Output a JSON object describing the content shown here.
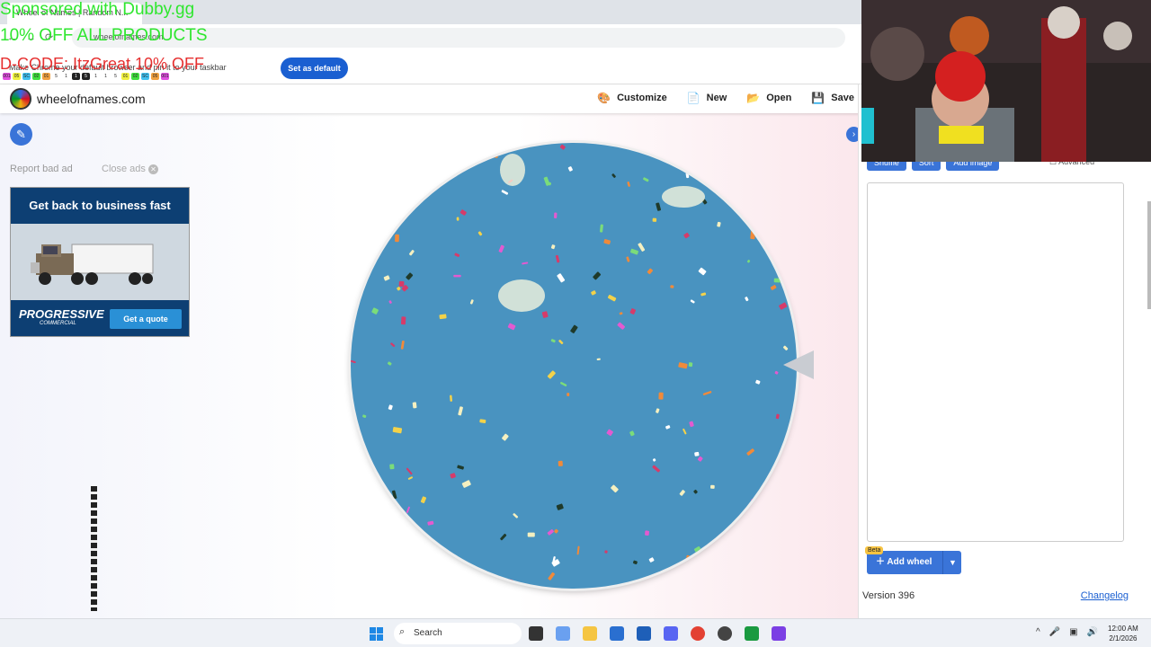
{
  "browser": {
    "tab_title": "Wheel of Names | Random N...",
    "url": "wheelofnames.com",
    "infobar_text": "Make Chrome your default browser and pin it to your taskbar",
    "set_default_label": "Set as default"
  },
  "stream_overlay": {
    "line1": "Sponsored with Dubby.gg",
    "line2": "10% OFF ALL PRODUCTS",
    "line3": "D-CODE: ItzGreat 10% OFF",
    "chips": [
      {
        "label": "001",
        "color": "#e050e0"
      },
      {
        "label": "05",
        "color": "#f0f040"
      },
      {
        "label": "SC",
        "color": "#40c0f0"
      },
      {
        "label": "02",
        "color": "#40e040"
      },
      {
        "label": "01",
        "color": "#f0a040"
      },
      {
        "label": "5",
        "color": "#ffffff"
      },
      {
        "label": "1",
        "color": "#ffffff"
      },
      {
        "label": "1",
        "color": "#222222"
      },
      {
        "label": "5",
        "color": "#222222"
      },
      {
        "label": "1",
        "color": "#ffffff"
      },
      {
        "label": "1",
        "color": "#ffffff"
      },
      {
        "label": "5",
        "color": "#ffffff"
      },
      {
        "label": "01",
        "color": "#f0f040"
      },
      {
        "label": "02",
        "color": "#40e040"
      },
      {
        "label": "SC",
        "color": "#40c0f0"
      },
      {
        "label": "05",
        "color": "#f0a040"
      },
      {
        "label": "001",
        "color": "#e050e0"
      }
    ]
  },
  "site": {
    "name": "wheelofnames.com",
    "menu": [
      {
        "label": "Customize",
        "icon": "palette-icon",
        "glyph": "🎨"
      },
      {
        "label": "New",
        "icon": "new-file-icon",
        "glyph": "📄"
      },
      {
        "label": "Open",
        "icon": "folder-open-icon",
        "glyph": "📂"
      },
      {
        "label": "Save",
        "icon": "save-icon",
        "glyph": "💾"
      }
    ],
    "report_label": "Report bad ad",
    "close_ads_label": "Close ads"
  },
  "ad": {
    "headline": "Get back to business fast",
    "brand": "PROGRESSIVE",
    "brand_sub": "COMMERCIAL",
    "cta": "Get a quote"
  },
  "panel": {
    "shuffle_label": "Shuffle",
    "sort_label": "Sort",
    "add_image_label": "Add image",
    "advanced_label": "Advanced",
    "add_wheel_label": "Add wheel",
    "beta_badge": "Beta",
    "version": "Version 396",
    "changelog": "Changelog"
  },
  "taskbar": {
    "search_placeholder": "Search",
    "time": "12:00 AM",
    "date": "2/1/2026"
  },
  "colors": {
    "accent": "#3a74d8",
    "wheel": "#4993c0",
    "overlay_green": "#2fe62f",
    "overlay_red": "#e63030"
  }
}
